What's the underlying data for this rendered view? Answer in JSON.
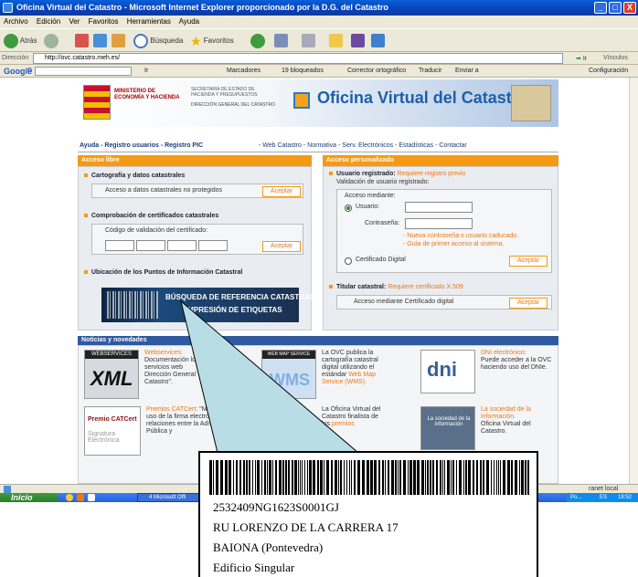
{
  "window": {
    "title": "Oficina Virtual del Catastro - Microsoft Internet Explorer proporcionado por la D.G. del Catastro",
    "controls": {
      "minimize": "_",
      "maximize": "□",
      "close": "X"
    }
  },
  "menu": [
    "Archivo",
    "Edición",
    "Ver",
    "Favoritos",
    "Herramientas",
    "Ayuda"
  ],
  "toolbar": {
    "back": "Atrás",
    "search": "Búsqueda",
    "favorites": "Favoritos"
  },
  "address": {
    "label": "Dirección",
    "url": "http://ovc.catastro.meh.es/",
    "go": "Ir",
    "links": "Vínculos"
  },
  "googlebar": {
    "logo": "Google",
    "prefix": "G",
    "go": "Ir",
    "bookmarks": "Marcadores",
    "blocked": "19 bloqueados",
    "spellcheck": "Corrector ortográfico",
    "translate": "Traducir",
    "send": "Enviar a",
    "settings": "Configuración"
  },
  "banner": {
    "ministry": "MINISTERIO DE ECONOMÍA Y HACIENDA",
    "secretaria": "SECRETARÍA DE ESTADO DE HACIENDA Y PRESUPUESTOS",
    "direccion": "DIRECCIÓN GENERAL DEL CATASTRO",
    "title": "Oficina Virtual del Catastro"
  },
  "nav": {
    "left": "Ayuda - Registro usuarios - Registro PIC",
    "right": "- Web Catastro - Normativa - Serv. Electrónicos - Estadísticas - Contactar"
  },
  "acceso_libre": {
    "header": "Acceso libre",
    "cartografia_title": "Cartografía y datos catastrales",
    "cartografia_text": "Acceso a datos catastrales no protegidos",
    "accept": "Aceptar",
    "comprobacion_title": "Comprobación de certificados catastrales",
    "codigo_label": "Código de validación del certificado:",
    "ubicacion_title": "Ubicación de los Puntos de Información Catastral"
  },
  "acceso_personalizado": {
    "header": "Acceso personalizado",
    "registrado_title": "Usuario registrado:",
    "registrado_req": "Requiere registro previo",
    "validacion": "Validación de usuario registrado:",
    "acceso_mediante": "Acceso mediante:",
    "usuario": "Usuario:",
    "contrasena": "Contraseña:",
    "nueva_contrasena": "- Nueva contraseña o usuario caducado.",
    "guia": "- Guía de primer acceso al sistema.",
    "certificado": "Certificado Digital",
    "accept": "Aceptar",
    "titular_title": "Titular catastral:",
    "titular_req": "Requiere certificado X.509",
    "titular_text": "Acceso mediante Certificado digital"
  },
  "consulta": {
    "line1": "BÚSQUEDA DE REFERENCIA CATASTRAL",
    "line2": "IMPRESIÓN DE ETIQUETAS"
  },
  "news": {
    "header": "Noticias y novedades",
    "webservices_badge": "WEBSERVICES",
    "xml": "XML",
    "ws_title": "Webservices:",
    "ws_body": "Documentación los servicios web Dirección General Catastro\".",
    "wms_badge": "WEB MAP SERVICE",
    "wms_img": "WMS",
    "wms_body1": "La OVC publica la cartografía catastral digital utilizando el estándar",
    "wms_link": "Web Map Service (WMS).",
    "dni_img": "dni",
    "dni_title": "DNI electrónico:",
    "dni_body": "Puede acceder a la OVC haciendo uso del DNIe.",
    "catcert_img": "Premio CATCert",
    "catcert_sub": "Signatura Electrònica",
    "catcert_title": "Premios CATCert:",
    "catcert_body": "\"Mejor iniciativa de uso de la firma electrónica en las relaciones entre la Administración Pública y",
    "finalista_body": "La Oficina Virtual del Catastro finalista de los",
    "finalista_link": "premios",
    "sociedad_img": "La sociedad de la información",
    "sociedad_title": "La sociedad de la información.",
    "sociedad_body": "Oficina Virtual del Catastro."
  },
  "status": {
    "zone": "ranet local"
  },
  "taskbar": {
    "start": "Inicio",
    "task": "4 Microsoft Offi",
    "tray_po": "Po...",
    "tray_lang": "ES",
    "time": "19:52"
  },
  "label": {
    "refcat": "2532409NG1623S0001GJ",
    "address": "RU LORENZO DE LA CARRERA 17",
    "city": "BAIONA (Pontevedra)",
    "type": "Edificio Singular"
  }
}
